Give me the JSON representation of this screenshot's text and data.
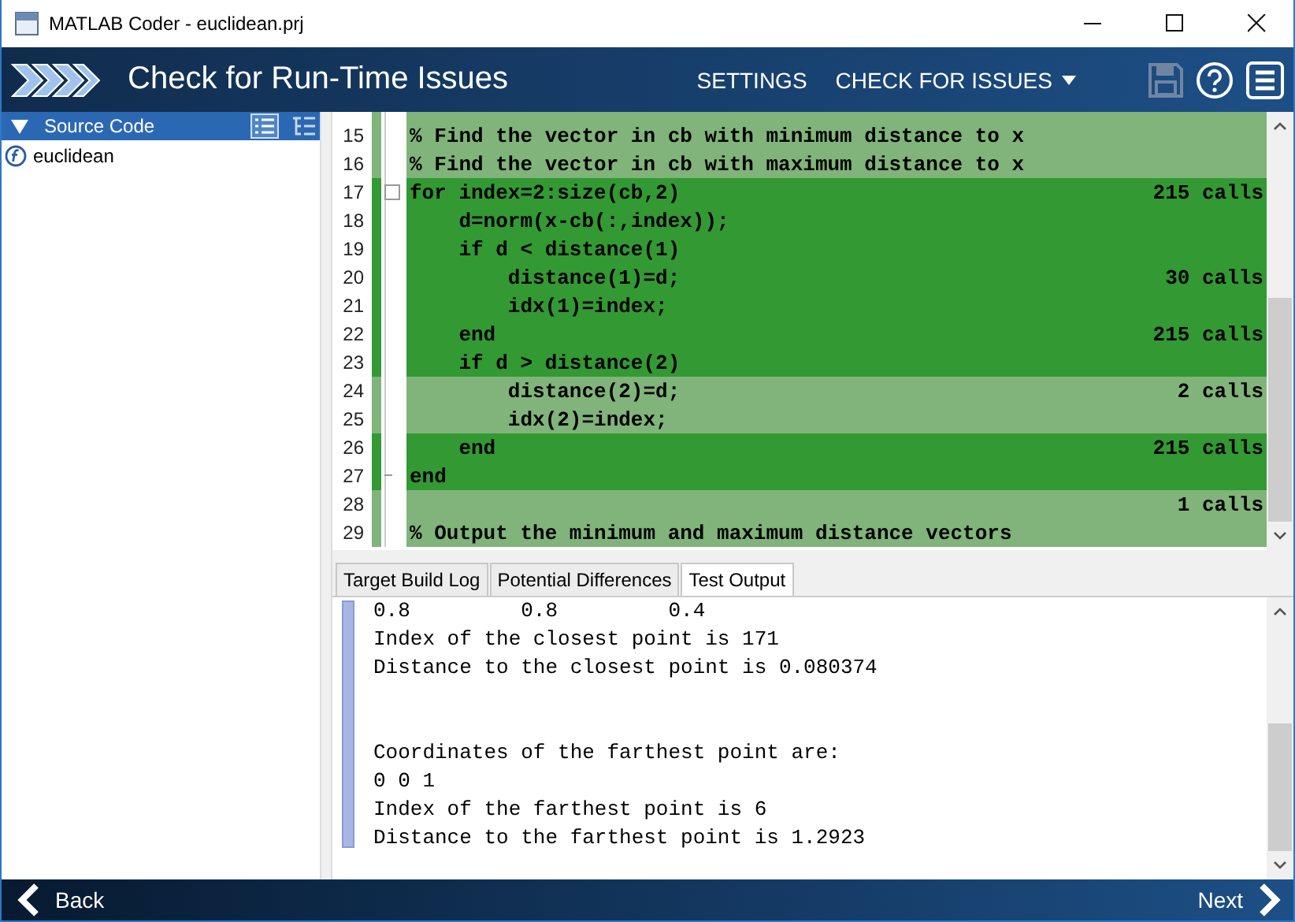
{
  "window": {
    "title": "MATLAB Coder - euclidean.prj"
  },
  "header": {
    "title": "Check for Run-Time Issues",
    "menu": [
      "SETTINGS",
      "CHECK FOR ISSUES"
    ]
  },
  "sidebar": {
    "title": "Source Code",
    "expanded": true,
    "items": [
      {
        "label": "euclidean",
        "selected": false
      }
    ]
  },
  "code": {
    "lines": [
      {
        "number": "15",
        "text": "% Find the vector in cb with minimum distance to x",
        "fully_covered": false,
        "fold_start": false,
        "fold_end": false
      },
      {
        "number": "16",
        "text": "% Find the vector in cb with maximum distance to x",
        "fully_covered": false,
        "fold_start": false,
        "fold_end": false
      },
      {
        "number": "17",
        "text": "for index=2:size(cb,2)",
        "calls": "215 calls",
        "fully_covered": true,
        "fold_start": true,
        "fold_end": false
      },
      {
        "number": "18",
        "text": "    d=norm(x-cb(:,index));",
        "fully_covered": true,
        "fold_start": false,
        "fold_end": false
      },
      {
        "number": "19",
        "text": "    if d < distance(1)",
        "fully_covered": true,
        "fold_start": false,
        "fold_end": false
      },
      {
        "number": "20",
        "text": "        distance(1)=d;",
        "calls": "30 calls",
        "fully_covered": true,
        "fold_start": false,
        "fold_end": false
      },
      {
        "number": "21",
        "text": "        idx(1)=index;",
        "fully_covered": true,
        "fold_start": false,
        "fold_end": false
      },
      {
        "number": "22",
        "text": "    end",
        "calls": "215 calls",
        "fully_covered": true,
        "fold_start": false,
        "fold_end": false
      },
      {
        "number": "23",
        "text": "    if d > distance(2)",
        "fully_covered": true,
        "fold_start": false,
        "fold_end": false
      },
      {
        "number": "24",
        "text": "        distance(2)=d;",
        "calls": "2 calls",
        "fully_covered": false,
        "fold_start": false,
        "fold_end": false
      },
      {
        "number": "25",
        "text": "        idx(2)=index;",
        "fully_covered": false,
        "fold_start": false,
        "fold_end": false
      },
      {
        "number": "26",
        "text": "    end",
        "calls": "215 calls",
        "fully_covered": true,
        "fold_start": false,
        "fold_end": false
      },
      {
        "number": "27",
        "text": "end",
        "fully_covered": true,
        "fold_start": false,
        "fold_end": true
      },
      {
        "number": "28",
        "calls": "1 calls",
        "fully_covered": false,
        "fold_start": false,
        "fold_end": false
      },
      {
        "number": "29",
        "text": "% Output the minimum and maximum distance vectors",
        "fully_covered": false,
        "fold_start": false,
        "fold_end": false
      }
    ]
  },
  "tabs": [
    {
      "label": "Target Build Log",
      "selected": false
    },
    {
      "label": "Potential Differences",
      "selected": false
    },
    {
      "label": "Test Output",
      "selected": true
    }
  ],
  "output": {
    "blocks": [
      {
        "lines": [
          "0.8         0.8         0.4",
          "Index of the closest point is 171",
          "Distance to the closest point is 0.080374"
        ]
      },
      {
        "lines": [
          "Coordinates of the farthest point are:",
          "0 0 1",
          "Index of the farthest point is 6",
          "Distance to the farthest point is 1.2923"
        ]
      }
    ]
  },
  "footer": {
    "back": "Back",
    "next": "Next"
  }
}
